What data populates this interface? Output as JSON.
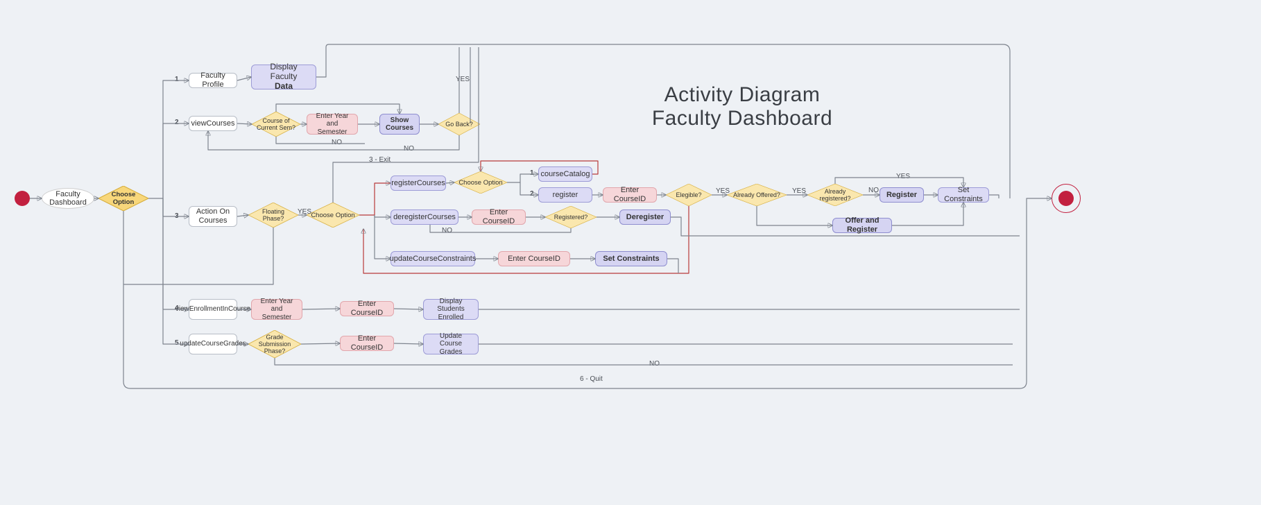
{
  "title_line1": "Activity Diagram",
  "title_line2": "Faculty Dashboard",
  "start": "Faculty Dashboard",
  "decisions": {
    "choose_option_root": "Choose Option",
    "course_of_current_sem": "Course of Current Sem?",
    "go_back": "Go Back?",
    "floating_phase": "Floating Phase?",
    "choose_option_actions": "Choose Option",
    "choose_option_reg": "Choose Option",
    "elegible": "Elegible?",
    "already_offered": "Already Offered?",
    "already_registered": "Already registered?",
    "registered": "Registered?",
    "grade_submission_phase": "Grade Submission Phase?"
  },
  "nodes": {
    "faculty_profile": "Faculty Profile",
    "display_faculty_data_l1": "Display Faculty",
    "display_faculty_data_l2": "Data",
    "view_courses": "viewCourses",
    "enter_year_sem": "Enter Year and Semester",
    "show_courses": "Show Courses",
    "action_on_courses": "Action On Courses",
    "register_courses": "registerCourses",
    "deregister_courses": "deregisterCourses",
    "update_constraints": "updateCourseConstraints",
    "course_catalog": "courseCatalog",
    "register_opt": "register",
    "enter_courseid_reg": "Enter CourseID",
    "register_btn": "Register",
    "set_constraints_right": "Set Constraints",
    "offer_and_register": "Offer and Register",
    "enter_courseid_dereg": "Enter CourseID",
    "deregister": "Deregister",
    "enter_courseid_set": "Enter CourseID",
    "set_constraints": "Set Constraints",
    "view_enrollment": "viewEnrollmentInCourse",
    "enter_year_sem2": "Enter Year and Semester",
    "enter_courseid_enroll": "Enter CourseID",
    "display_students": "Display Students Enrolled",
    "update_course_grades": "updateCourseGrades",
    "enter_courseid_grades": "Enter CourseID",
    "update_grades_box": "Update Course Grades"
  },
  "labels": {
    "opt1": "1",
    "opt2": "2",
    "opt3": "3",
    "opt4": "4",
    "opt5": "5",
    "quit6": "6 - Quit",
    "exit3": "3 - Exit",
    "yes": "YES",
    "no": "NO",
    "reg1": "1",
    "reg2": "2"
  }
}
